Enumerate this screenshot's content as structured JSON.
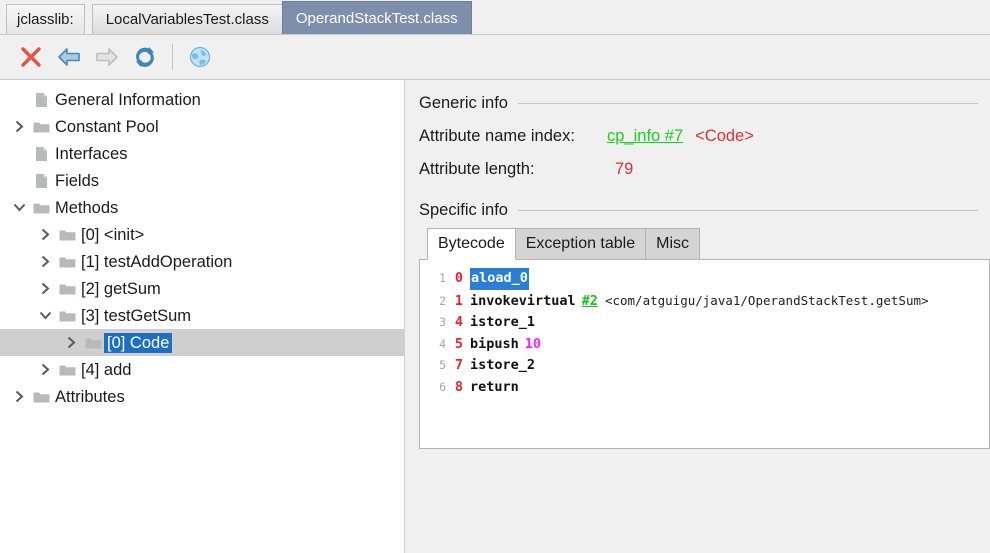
{
  "window": {
    "app_label": "jclasslib:",
    "tabs": [
      {
        "label": "LocalVariablesTest.class",
        "active": false
      },
      {
        "label": "OperandStackTest.class",
        "active": true
      }
    ]
  },
  "toolbar": {
    "buttons": [
      {
        "name": "close-icon",
        "title": "Close"
      },
      {
        "name": "back-arrow-icon",
        "title": "Backward"
      },
      {
        "name": "forward-arrow-icon",
        "title": "Forward"
      },
      {
        "name": "reload-icon",
        "title": "Reload"
      },
      {
        "name": "browse-classpath-icon",
        "title": "Browse"
      }
    ]
  },
  "tree": {
    "items": [
      {
        "label": "General Information",
        "indent": 1,
        "icon": "page-icon",
        "twisty": "none",
        "selected": false
      },
      {
        "label": "Constant Pool",
        "indent": 1,
        "icon": "folder-icon",
        "twisty": "collapsed",
        "selected": false
      },
      {
        "label": "Interfaces",
        "indent": 1,
        "icon": "page-icon",
        "twisty": "none",
        "selected": false
      },
      {
        "label": "Fields",
        "indent": 1,
        "icon": "page-icon",
        "twisty": "none",
        "selected": false
      },
      {
        "label": "Methods",
        "indent": 1,
        "icon": "folder-icon",
        "twisty": "expanded",
        "selected": false
      },
      {
        "label": "[0] <init>",
        "indent": 2,
        "icon": "folder-icon",
        "twisty": "collapsed",
        "selected": false
      },
      {
        "label": "[1] testAddOperation",
        "indent": 2,
        "icon": "folder-icon",
        "twisty": "collapsed",
        "selected": false
      },
      {
        "label": "[2] getSum",
        "indent": 2,
        "icon": "folder-icon",
        "twisty": "collapsed",
        "selected": false
      },
      {
        "label": "[3] testGetSum",
        "indent": 2,
        "icon": "folder-icon",
        "twisty": "expanded",
        "selected": false
      },
      {
        "label": "[0] Code",
        "indent": 3,
        "icon": "folder-icon",
        "twisty": "collapsed",
        "selected": true
      },
      {
        "label": "[4] add",
        "indent": 2,
        "icon": "folder-icon",
        "twisty": "collapsed",
        "selected": false
      },
      {
        "label": "Attributes",
        "indent": 1,
        "icon": "folder-icon",
        "twisty": "collapsed",
        "selected": false
      }
    ]
  },
  "detail": {
    "generic_info_title": "Generic info",
    "specific_info_title": "Specific info",
    "fields": [
      {
        "key": "Attribute name index:",
        "link": "cp_info #7",
        "red": "<Code>"
      },
      {
        "key": "Attribute length:",
        "link": "",
        "red": "79"
      }
    ],
    "inner_tabs": [
      {
        "label": "Bytecode",
        "active": true
      },
      {
        "label": "Exception table",
        "active": false
      },
      {
        "label": "Misc",
        "active": false
      }
    ],
    "bytecode": [
      {
        "line": "1",
        "offset": "0",
        "op": "aload_0",
        "selected": true,
        "cpref": "",
        "comment": "",
        "number": ""
      },
      {
        "line": "2",
        "offset": "1",
        "op": "invokevirtual",
        "selected": false,
        "cpref": "#2",
        "comment": "<com/atguigu/java1/OperandStackTest.getSum>",
        "number": ""
      },
      {
        "line": "3",
        "offset": "4",
        "op": "istore_1",
        "selected": false,
        "cpref": "",
        "comment": "",
        "number": ""
      },
      {
        "line": "4",
        "offset": "5",
        "op": "bipush",
        "selected": false,
        "cpref": "",
        "comment": "",
        "number": "10"
      },
      {
        "line": "5",
        "offset": "7",
        "op": "istore_2",
        "selected": false,
        "cpref": "",
        "comment": "",
        "number": ""
      },
      {
        "line": "6",
        "offset": "8",
        "op": "return",
        "selected": false,
        "cpref": "",
        "comment": "",
        "number": ""
      }
    ]
  },
  "colors": {
    "active_tab_bg": "#7e8fab",
    "selection_blue": "#1d6fc0",
    "link_green": "#19d119",
    "value_red": "#e03030",
    "number_magenta": "#ff20ff",
    "panel_bg": "#f0f0f0"
  }
}
